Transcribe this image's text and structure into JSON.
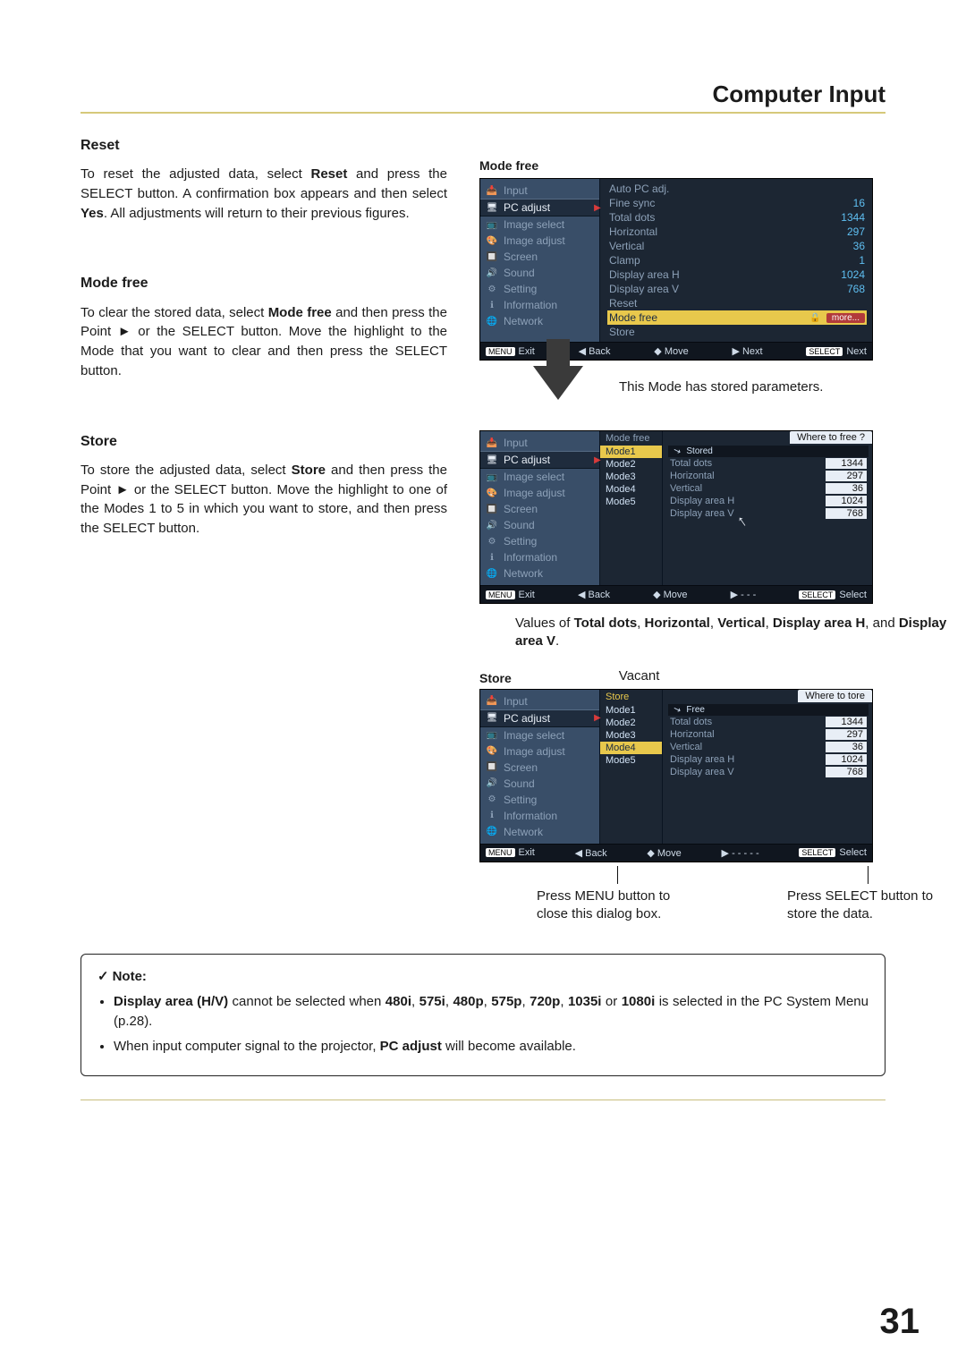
{
  "header": "Computer Input",
  "page_number": "31",
  "text": {
    "reset": {
      "title": "Reset",
      "p1_a": "To reset the adjusted data, select ",
      "p1_b": "Reset",
      "p1_c": " and press the SELECT button. A confirmation box appears and then select ",
      "p1_d": "Yes",
      "p1_e": ". All adjustments will return to their previous figures."
    },
    "modefree": {
      "title": "Mode free",
      "p1_a": "To clear the stored data, select ",
      "p1_b": "Mode free",
      "p1_c": " and then press the Point ► or the SELECT button. Move the highlight to the Mode that you want to clear and then press the SELECT button."
    },
    "store": {
      "title": "Store",
      "p1_a": "To store the adjusted data, select ",
      "p1_b": "Store",
      "p1_c": " and then press the Point ► or the SELECT button. Move the highlight to one of the Modes 1 to 5 in which you want to store, and then press the SELECT button."
    }
  },
  "right_labels": {
    "modefree": "Mode free",
    "stored_ann": "This Mode has stored parameters.",
    "values_ann_a": "Values of ",
    "values_ann_b": "Total dots",
    "values_ann_c": ", ",
    "values_ann_d": "Horizontal",
    "values_ann_e": ", ",
    "values_ann_f": "Vertical",
    "values_ann_g": ", ",
    "values_ann_h": "Display area H",
    "values_ann_i": ", and ",
    "values_ann_j": "Display area V",
    "values_ann_k": ".",
    "store": "Store",
    "vacant": "Vacant",
    "press_menu": "Press MENU button to close this dialog box.",
    "press_select": "Press SELECT button to store the data."
  },
  "osd": {
    "side": [
      {
        "icon": "📥",
        "label": "Input"
      },
      {
        "icon": "🖥",
        "label": "PC adjust",
        "sel": true
      },
      {
        "icon": "📺",
        "label": "Image select"
      },
      {
        "icon": "🎨",
        "label": "Image adjust"
      },
      {
        "icon": "🔲",
        "label": "Screen"
      },
      {
        "icon": "🔊",
        "label": "Sound"
      },
      {
        "icon": "⚙",
        "label": "Setting"
      },
      {
        "icon": "ℹ",
        "label": "Information"
      },
      {
        "icon": "🌐",
        "label": "Network"
      }
    ],
    "pc_adjust_rows": [
      {
        "lab": "Auto PC adj.",
        "val": ""
      },
      {
        "lab": "Fine sync",
        "val": "16"
      },
      {
        "lab": "Total dots",
        "val": "1344"
      },
      {
        "lab": "Horizontal",
        "val": "297"
      },
      {
        "lab": "Vertical",
        "val": "36"
      },
      {
        "lab": "Clamp",
        "val": "1"
      },
      {
        "lab": "Display area H",
        "val": "1024"
      },
      {
        "lab": "Display area V",
        "val": "768"
      },
      {
        "lab": "Reset",
        "val": ""
      }
    ],
    "modefree_row": {
      "lab": "Mode free",
      "more": "more..."
    },
    "store_row": {
      "lab": "Store"
    },
    "foot_exit_label": "Exit",
    "foot_exit_pill": "MENU",
    "foot_back": "◀ Back",
    "foot_move": "◆ Move",
    "foot_next": "▶ Next",
    "foot_next2": "▶ - - -",
    "foot_next3": "▶ - - - - -",
    "foot_sel_pill": "SELECT",
    "foot_sel_label_next": "Next",
    "foot_sel_label_sel": "Select"
  },
  "mode_panel": {
    "head_free": "Mode free",
    "head_store": "Store",
    "where_free": "Where to free ?",
    "where_store": "Where to   tore",
    "stored_tag": "Stored",
    "free_tag": "Free",
    "modes": [
      "Mode1",
      "Mode2",
      "Mode3",
      "Mode4",
      "Mode5"
    ],
    "val_rows": [
      {
        "lab": "Total dots",
        "v": "1344"
      },
      {
        "lab": "Horizontal",
        "v": "297"
      },
      {
        "lab": "Vertical",
        "v": "36"
      },
      {
        "lab": "Display area H",
        "v": "1024"
      },
      {
        "lab": "Display area V",
        "v": "768"
      }
    ]
  },
  "note": {
    "title": "Note:",
    "li1_a": "Display area (H/V)",
    "li1_b": " cannot be selected when ",
    "li1_c": "480i",
    "li1_d": ", ",
    "li1_e": "575i",
    "li1_f": ", ",
    "li1_g": "480p",
    "li1_h": ", ",
    "li1_i": "575p",
    "li1_j": ", ",
    "li1_k": "720p",
    "li1_l": ", ",
    "li1_m": "1035i",
    "li1_n": " or ",
    "li1_o": "1080i",
    "li1_p": " is selected in the PC System Menu (p.28).",
    "li2_a": "When input computer signal to the projector, ",
    "li2_b": "PC adjust",
    "li2_c": " will become available."
  }
}
